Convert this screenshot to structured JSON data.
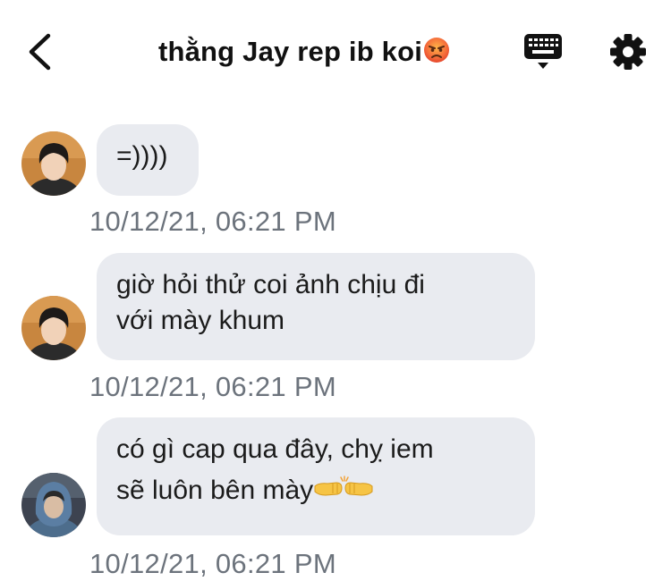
{
  "header": {
    "title": "thằng Jay rep ib koi",
    "title_emoji": "angry-face-emoji",
    "back_icon": "chevron-left-icon",
    "keyboard_icon": "keyboard-icon",
    "settings_icon": "gear-icon"
  },
  "messages": [
    {
      "text": "=))))",
      "timestamp": "10/12/21, 06:21 PM",
      "avatar": "sender-avatar-1"
    },
    {
      "text": "giờ hỏi thử coi ảnh chịu đi\nvới mày khum",
      "line1": "giờ hỏi thử coi ảnh chịu đi",
      "line2": "với mày khum",
      "timestamp": "10/12/21, 06:21 PM",
      "avatar": "sender-avatar-1"
    },
    {
      "line1": "có gì cap qua đây, chỵ iem",
      "line2": "sẽ luôn bên mày",
      "trailing_emoji": "fist-bump-emoji",
      "timestamp": "10/12/21, 06:21 PM",
      "avatar": "sender-avatar-2"
    }
  ],
  "colors": {
    "bubble_background": "#e9ebf0",
    "timestamp_text": "#6c737c",
    "title_text": "#111111"
  }
}
